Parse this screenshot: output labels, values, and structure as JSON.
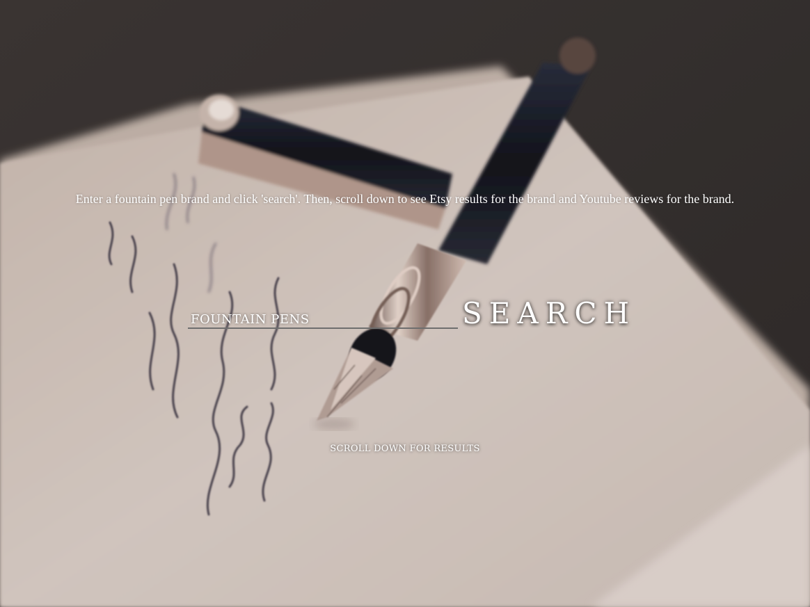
{
  "instructions": {
    "text": "Enter a fountain pen brand and click 'search'. Then, scroll down to see Etsy results for the brand and Youtube reviews for the brand."
  },
  "search": {
    "placeholder": "FOUNTAIN PENS",
    "value": "",
    "button_label": "SEARCH"
  },
  "scroll_hint": {
    "text": "SCROLL DOWN FOR RESULTS"
  },
  "background": {
    "description_icon": "fountain-pen-on-paper-photo",
    "colors": {
      "dark_table": "#3b3533",
      "paper": "#d8cbc4",
      "pen_barrel": "#1c1f2b",
      "chrome": "#c9b2a8",
      "ink": "#4a4550"
    }
  }
}
